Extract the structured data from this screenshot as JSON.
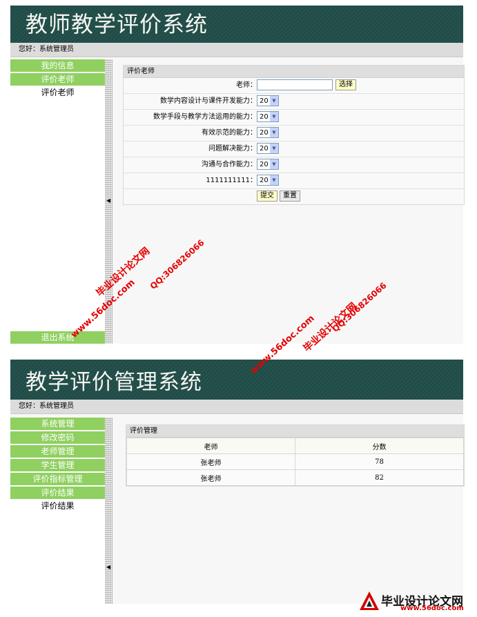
{
  "teacher_screen": {
    "banner_title": "教师教学评价系统",
    "greeting": "您好：系统管理员",
    "sidebar": {
      "items": [
        {
          "label": "我的信息"
        },
        {
          "label": "评价老师"
        }
      ],
      "sub_label": "评价老师",
      "logout_label": "退出系统"
    },
    "form": {
      "title": "评价老师",
      "teacher_label": "老师：",
      "teacher_value": "",
      "choose_button": "选择",
      "criteria": [
        {
          "label": "数学内容设计与课件开发能力：",
          "value": "20"
        },
        {
          "label": "数学手段与教学方法运用的能力：",
          "value": "20"
        },
        {
          "label": "有效示范的能力：",
          "value": "20"
        },
        {
          "label": "问题解决能力：",
          "value": "20"
        },
        {
          "label": "沟通与合作能力：",
          "value": "20"
        },
        {
          "label": "1111111111：",
          "value": "20"
        }
      ],
      "submit_button": "提交",
      "reset_button": "重置"
    }
  },
  "admin_screen": {
    "banner_title": "教学评价管理系统",
    "greeting": "您好：系统管理员",
    "sidebar": {
      "items": [
        {
          "label": "系统管理"
        },
        {
          "label": "修改密码"
        },
        {
          "label": "老师管理"
        },
        {
          "label": "学生管理"
        },
        {
          "label": "评价指标管理"
        },
        {
          "label": "评价结果"
        }
      ],
      "sub_label": "评价结果"
    },
    "results": {
      "title": "评价管理",
      "columns": [
        "老师",
        "分数"
      ],
      "rows": [
        [
          "张老师",
          "78"
        ],
        [
          "张老师",
          "82"
        ]
      ]
    }
  },
  "watermarks": {
    "site": "www.56doc.com",
    "qq": "QQ:306826066",
    "name": "毕业设计论文网",
    "logo_text": "毕业设计论文网",
    "logo_url": "www.56doc.com"
  },
  "colors": {
    "banner": "#1f4b46",
    "sidebar_button": "#8fd060",
    "watermark": "#e60000"
  },
  "icons": {
    "dropdown": "chevron-down-icon",
    "collapse": "triangle-left-icon"
  }
}
